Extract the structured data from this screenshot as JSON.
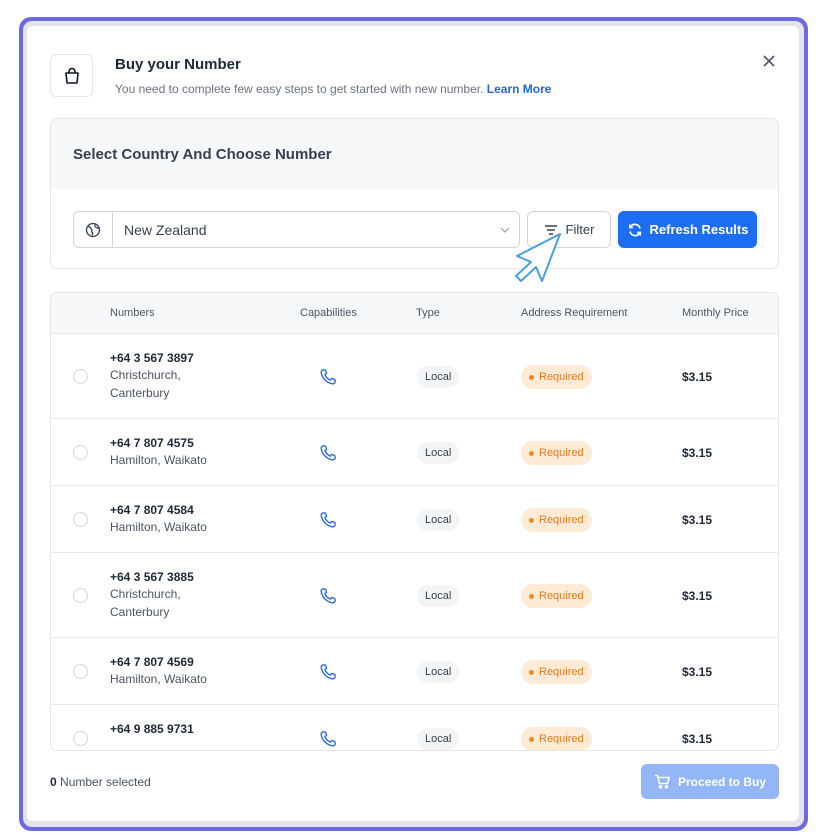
{
  "header": {
    "title": "Buy your Number",
    "subtitle": "You need to complete few easy steps to get started with new number.",
    "learn_more": "Learn More",
    "close_label": "×"
  },
  "selector": {
    "panel_title": "Select Country And Choose Number",
    "country": "New Zealand",
    "filter_label": "Filter",
    "refresh_label": "Refresh Results"
  },
  "table": {
    "columns": [
      "Numbers",
      "Capabilities",
      "Type",
      "Address Requirement",
      "Monthly Price"
    ],
    "rows": [
      {
        "number": "+64 3 567 3897",
        "location": "Christchurch, Canterbury",
        "type": "Local",
        "address": "Required",
        "price": "$3.15"
      },
      {
        "number": "+64 7 807 4575",
        "location": "Hamilton, Waikato",
        "type": "Local",
        "address": "Required",
        "price": "$3.15"
      },
      {
        "number": "+64 7 807 4584",
        "location": "Hamilton, Waikato",
        "type": "Local",
        "address": "Required",
        "price": "$3.15"
      },
      {
        "number": "+64 3 567 3885",
        "location": "Christchurch, Canterbury",
        "type": "Local",
        "address": "Required",
        "price": "$3.15"
      },
      {
        "number": "+64 7 807 4569",
        "location": "Hamilton, Waikato",
        "type": "Local",
        "address": "Required",
        "price": "$3.15"
      },
      {
        "number": "+64 9 885 9731",
        "location": "",
        "type": "Local",
        "address": "Required",
        "price": "$3.15"
      }
    ]
  },
  "footer": {
    "selected_count": "0",
    "selected_label": "Number selected",
    "proceed_label": "Proceed to Buy"
  },
  "colors": {
    "accent": "#1d6ef5",
    "frame": "#6d6adf",
    "required_text": "#e87a1a",
    "required_bg": "#fdebd6"
  },
  "icons": {
    "header": "shopping-bag-icon",
    "close": "close-icon",
    "country": "globe-icon",
    "dropdown": "chevron-down-icon",
    "filter": "filter-icon",
    "refresh": "refresh-icon",
    "capability": "phone-icon",
    "proceed": "cart-icon",
    "pointer": "cursor-arrow-icon"
  }
}
